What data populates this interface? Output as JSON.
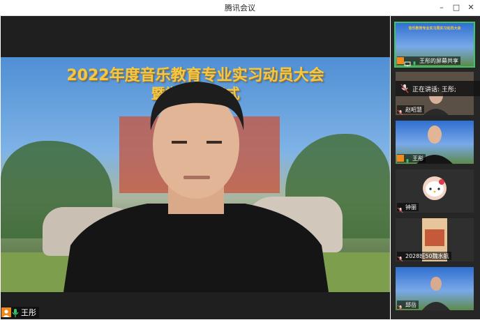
{
  "window": {
    "title": "腾讯会议",
    "minimize": "–",
    "maximize": "□",
    "close": "✕"
  },
  "main": {
    "banner_line1": "2022年度音乐教育专业实习动员大会",
    "banner_line2": "暨学          启动仪式",
    "speaker_name": "王彤"
  },
  "sidebar": {
    "tiles": [
      {
        "label": "王彤的屏幕共享",
        "slide_text": "音乐教育专业实习周实习动员大会"
      },
      {
        "label": "赵昭慧"
      },
      {
        "label": "王彤"
      },
      {
        "label": "钟丽"
      },
      {
        "label": "2028班50魏水航"
      },
      {
        "label": "邱岳"
      }
    ],
    "speaking_label": "正在讲话: 王彤;"
  },
  "colors": {
    "accent": "#3fc46b",
    "avatar": "#f08a1c",
    "banner_text": "#f2c84b"
  }
}
